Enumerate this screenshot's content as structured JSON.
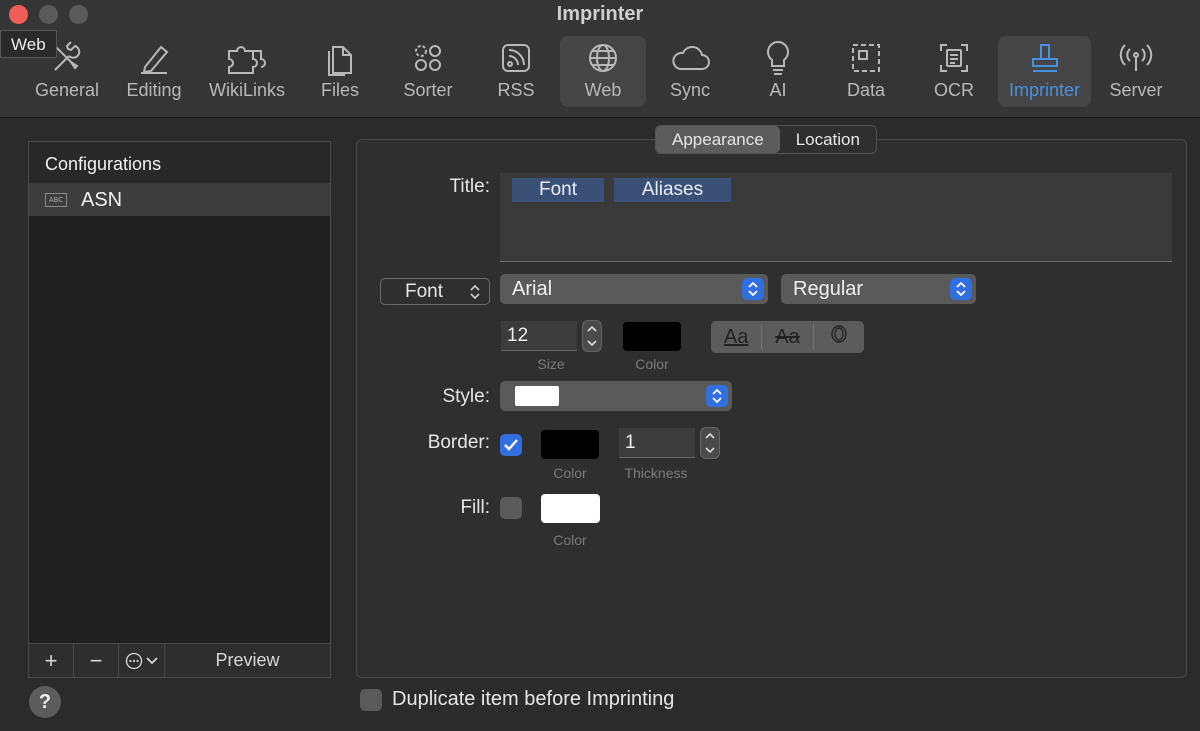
{
  "window": {
    "title": "Imprinter"
  },
  "tooltip": "Web",
  "tabs": [
    {
      "label": "General",
      "icon": "tools-icon"
    },
    {
      "label": "Editing",
      "icon": "pencil-icon"
    },
    {
      "label": "WikiLinks",
      "icon": "puzzle-icon"
    },
    {
      "label": "Files",
      "icon": "files-icon"
    },
    {
      "label": "Sorter",
      "icon": "sorter-icon"
    },
    {
      "label": "RSS",
      "icon": "rss-icon"
    },
    {
      "label": "Web",
      "icon": "globe-icon"
    },
    {
      "label": "Sync",
      "icon": "cloud-icon"
    },
    {
      "label": "AI",
      "icon": "lightbulb-icon"
    },
    {
      "label": "Data",
      "icon": "data-icon"
    },
    {
      "label": "OCR",
      "icon": "ocr-icon"
    },
    {
      "label": "Imprinter",
      "icon": "stamp-icon",
      "active": true
    },
    {
      "label": "Server",
      "icon": "antenna-icon"
    }
  ],
  "configurations": {
    "header": "Configurations",
    "items": [
      {
        "name": "ASN",
        "icon": "abc-field-icon",
        "selected": true
      }
    ],
    "footer": {
      "add": "+",
      "remove": "−",
      "preview": "Preview"
    }
  },
  "segments": [
    {
      "label": "Appearance",
      "selected": true
    },
    {
      "label": "Location"
    }
  ],
  "form": {
    "title_label": "Title:",
    "title_tokens": [
      "Font",
      "Aliases"
    ],
    "font_button": "Font",
    "font_family": "Arial",
    "font_style": "Regular",
    "size_value": "12",
    "size_caption": "Size",
    "color_caption": "Color",
    "font_color": "#000000",
    "text_buttons": [
      "Aa",
      "Aa"
    ],
    "style_label": "Style:",
    "style_swatch": "#ffffff",
    "border_label": "Border:",
    "border_checked": true,
    "border_color": "#000000",
    "border_color_caption": "Color",
    "thickness_value": "1",
    "thickness_caption": "Thickness",
    "fill_label": "Fill:",
    "fill_checked": false,
    "fill_color": "#ffffff",
    "fill_color_caption": "Color"
  },
  "duplicate_label": "Duplicate item before Imprinting",
  "accent_color": "#2f6fe0",
  "help": "?"
}
